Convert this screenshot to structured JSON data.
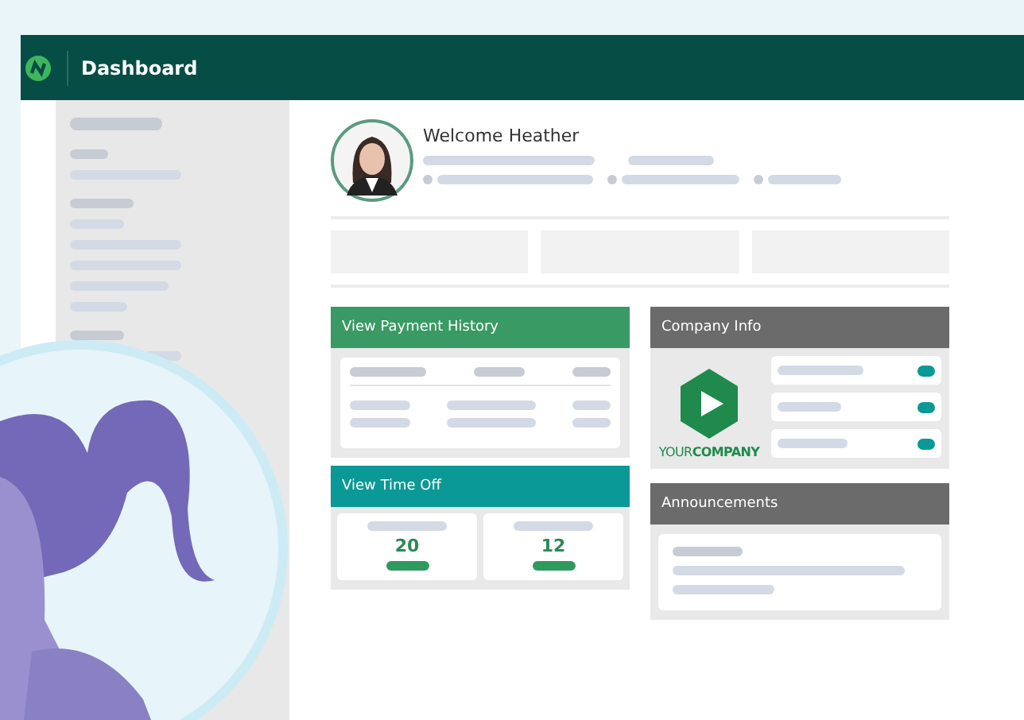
{
  "header": {
    "title": "Dashboard"
  },
  "welcome": {
    "text": "Welcome Heather"
  },
  "payment_card": {
    "title": "View Payment History"
  },
  "time_off_card": {
    "title": "View Time Off",
    "counts": [
      "20",
      "12"
    ]
  },
  "company_card": {
    "title": "Company Info",
    "logo_text": "YOUR**COMPANY**"
  },
  "announcements_card": {
    "title": "Announcements"
  }
}
